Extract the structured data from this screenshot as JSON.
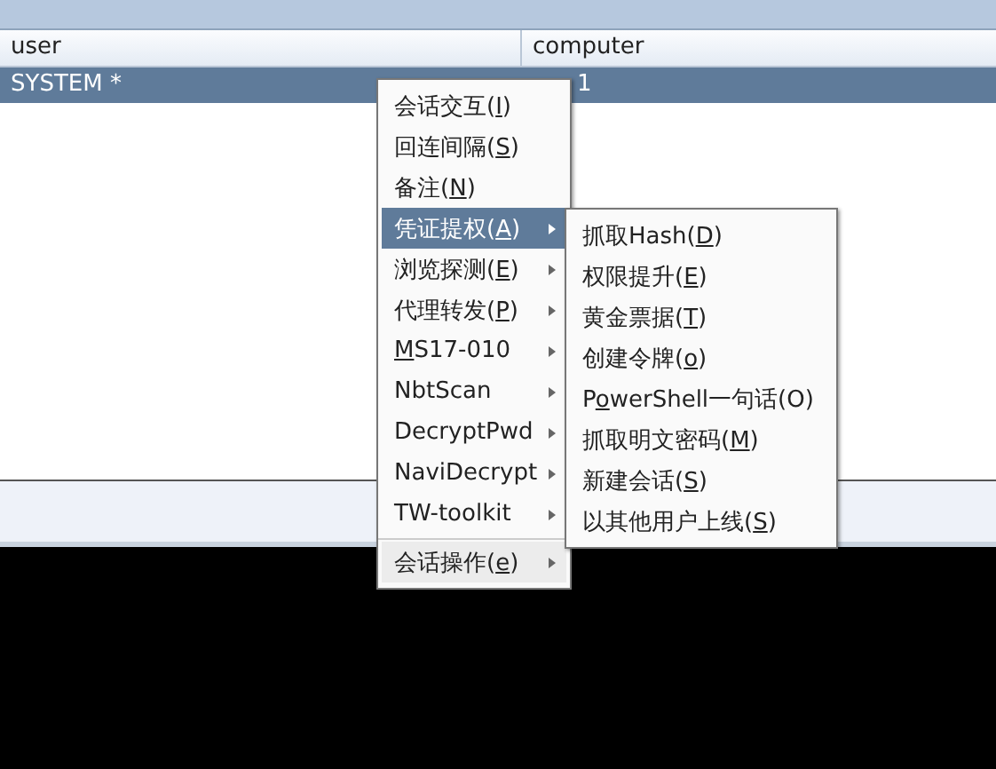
{
  "table": {
    "columns": [
      "user",
      "computer"
    ],
    "rows": [
      {
        "cells": [
          "SYSTEM *",
          "1"
        ],
        "selected": true
      }
    ]
  },
  "context_menu": {
    "items": [
      {
        "before": "会话交互(",
        "key": "I",
        "after": ")",
        "has_submenu": false,
        "selected": false,
        "separator_before": false
      },
      {
        "before": "回连间隔(",
        "key": "S",
        "after": ")",
        "has_submenu": false,
        "selected": false,
        "separator_before": false
      },
      {
        "before": "备注(",
        "key": "N",
        "after": ")",
        "has_submenu": false,
        "selected": false,
        "separator_before": false
      },
      {
        "before": "凭证提权(",
        "key": "A",
        "after": ")",
        "has_submenu": true,
        "selected": true,
        "separator_before": false
      },
      {
        "before": "浏览探测(",
        "key": "E",
        "after": ")",
        "has_submenu": true,
        "selected": false,
        "separator_before": false
      },
      {
        "before": "代理转发(",
        "key": "P",
        "after": ")",
        "has_submenu": true,
        "selected": false,
        "separator_before": false
      },
      {
        "key": "M",
        "after": "S17-010",
        "has_submenu": true,
        "selected": false,
        "separator_before": false
      },
      {
        "before": "NbtScan",
        "has_submenu": true,
        "selected": false,
        "separator_before": false
      },
      {
        "before": "DecryptPwd",
        "has_submenu": true,
        "selected": false,
        "separator_before": false
      },
      {
        "before": "NaviDecrypt",
        "has_submenu": true,
        "selected": false,
        "separator_before": false
      },
      {
        "before": "TW-toolkit",
        "has_submenu": true,
        "selected": false,
        "separator_before": false
      },
      {
        "before": "会话操作(",
        "key": "e",
        "after": ")",
        "has_submenu": true,
        "selected": false,
        "separator_before": true
      }
    ]
  },
  "submenu": {
    "items": [
      {
        "before": "抓取Hash(",
        "key": "D",
        "after": ")"
      },
      {
        "before": "权限提升(",
        "key": "E",
        "after": ")"
      },
      {
        "before": "黄金票据(",
        "key": "T",
        "after": ")"
      },
      {
        "before": "创建令牌(",
        "key": "o",
        "after": ")"
      },
      {
        "before": "P",
        "key": "o",
        "after": "werShell一句话(O)"
      },
      {
        "before": "抓取明文密码(",
        "key": "M",
        "after": ")"
      },
      {
        "before": "新建会话(",
        "key": "S",
        "after": ")"
      },
      {
        "before": "以其他用户上线(",
        "key": "S",
        "after": ")"
      }
    ]
  }
}
